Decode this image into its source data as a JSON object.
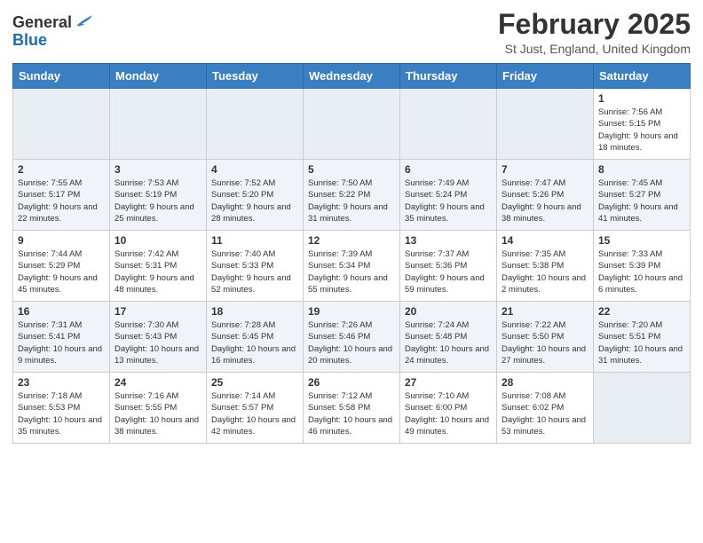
{
  "logo": {
    "general": "General",
    "blue": "Blue"
  },
  "title": "February 2025",
  "location": "St Just, England, United Kingdom",
  "days_of_week": [
    "Sunday",
    "Monday",
    "Tuesday",
    "Wednesday",
    "Thursday",
    "Friday",
    "Saturday"
  ],
  "weeks": [
    [
      {
        "day": "",
        "info": ""
      },
      {
        "day": "",
        "info": ""
      },
      {
        "day": "",
        "info": ""
      },
      {
        "day": "",
        "info": ""
      },
      {
        "day": "",
        "info": ""
      },
      {
        "day": "",
        "info": ""
      },
      {
        "day": "1",
        "info": "Sunrise: 7:56 AM\nSunset: 5:15 PM\nDaylight: 9 hours and 18 minutes."
      }
    ],
    [
      {
        "day": "2",
        "info": "Sunrise: 7:55 AM\nSunset: 5:17 PM\nDaylight: 9 hours and 22 minutes."
      },
      {
        "day": "3",
        "info": "Sunrise: 7:53 AM\nSunset: 5:19 PM\nDaylight: 9 hours and 25 minutes."
      },
      {
        "day": "4",
        "info": "Sunrise: 7:52 AM\nSunset: 5:20 PM\nDaylight: 9 hours and 28 minutes."
      },
      {
        "day": "5",
        "info": "Sunrise: 7:50 AM\nSunset: 5:22 PM\nDaylight: 9 hours and 31 minutes."
      },
      {
        "day": "6",
        "info": "Sunrise: 7:49 AM\nSunset: 5:24 PM\nDaylight: 9 hours and 35 minutes."
      },
      {
        "day": "7",
        "info": "Sunrise: 7:47 AM\nSunset: 5:26 PM\nDaylight: 9 hours and 38 minutes."
      },
      {
        "day": "8",
        "info": "Sunrise: 7:45 AM\nSunset: 5:27 PM\nDaylight: 9 hours and 41 minutes."
      }
    ],
    [
      {
        "day": "9",
        "info": "Sunrise: 7:44 AM\nSunset: 5:29 PM\nDaylight: 9 hours and 45 minutes."
      },
      {
        "day": "10",
        "info": "Sunrise: 7:42 AM\nSunset: 5:31 PM\nDaylight: 9 hours and 48 minutes."
      },
      {
        "day": "11",
        "info": "Sunrise: 7:40 AM\nSunset: 5:33 PM\nDaylight: 9 hours and 52 minutes."
      },
      {
        "day": "12",
        "info": "Sunrise: 7:39 AM\nSunset: 5:34 PM\nDaylight: 9 hours and 55 minutes."
      },
      {
        "day": "13",
        "info": "Sunrise: 7:37 AM\nSunset: 5:36 PM\nDaylight: 9 hours and 59 minutes."
      },
      {
        "day": "14",
        "info": "Sunrise: 7:35 AM\nSunset: 5:38 PM\nDaylight: 10 hours and 2 minutes."
      },
      {
        "day": "15",
        "info": "Sunrise: 7:33 AM\nSunset: 5:39 PM\nDaylight: 10 hours and 6 minutes."
      }
    ],
    [
      {
        "day": "16",
        "info": "Sunrise: 7:31 AM\nSunset: 5:41 PM\nDaylight: 10 hours and 9 minutes."
      },
      {
        "day": "17",
        "info": "Sunrise: 7:30 AM\nSunset: 5:43 PM\nDaylight: 10 hours and 13 minutes."
      },
      {
        "day": "18",
        "info": "Sunrise: 7:28 AM\nSunset: 5:45 PM\nDaylight: 10 hours and 16 minutes."
      },
      {
        "day": "19",
        "info": "Sunrise: 7:26 AM\nSunset: 5:46 PM\nDaylight: 10 hours and 20 minutes."
      },
      {
        "day": "20",
        "info": "Sunrise: 7:24 AM\nSunset: 5:48 PM\nDaylight: 10 hours and 24 minutes."
      },
      {
        "day": "21",
        "info": "Sunrise: 7:22 AM\nSunset: 5:50 PM\nDaylight: 10 hours and 27 minutes."
      },
      {
        "day": "22",
        "info": "Sunrise: 7:20 AM\nSunset: 5:51 PM\nDaylight: 10 hours and 31 minutes."
      }
    ],
    [
      {
        "day": "23",
        "info": "Sunrise: 7:18 AM\nSunset: 5:53 PM\nDaylight: 10 hours and 35 minutes."
      },
      {
        "day": "24",
        "info": "Sunrise: 7:16 AM\nSunset: 5:55 PM\nDaylight: 10 hours and 38 minutes."
      },
      {
        "day": "25",
        "info": "Sunrise: 7:14 AM\nSunset: 5:57 PM\nDaylight: 10 hours and 42 minutes."
      },
      {
        "day": "26",
        "info": "Sunrise: 7:12 AM\nSunset: 5:58 PM\nDaylight: 10 hours and 46 minutes."
      },
      {
        "day": "27",
        "info": "Sunrise: 7:10 AM\nSunset: 6:00 PM\nDaylight: 10 hours and 49 minutes."
      },
      {
        "day": "28",
        "info": "Sunrise: 7:08 AM\nSunset: 6:02 PM\nDaylight: 10 hours and 53 minutes."
      },
      {
        "day": "",
        "info": ""
      }
    ]
  ]
}
